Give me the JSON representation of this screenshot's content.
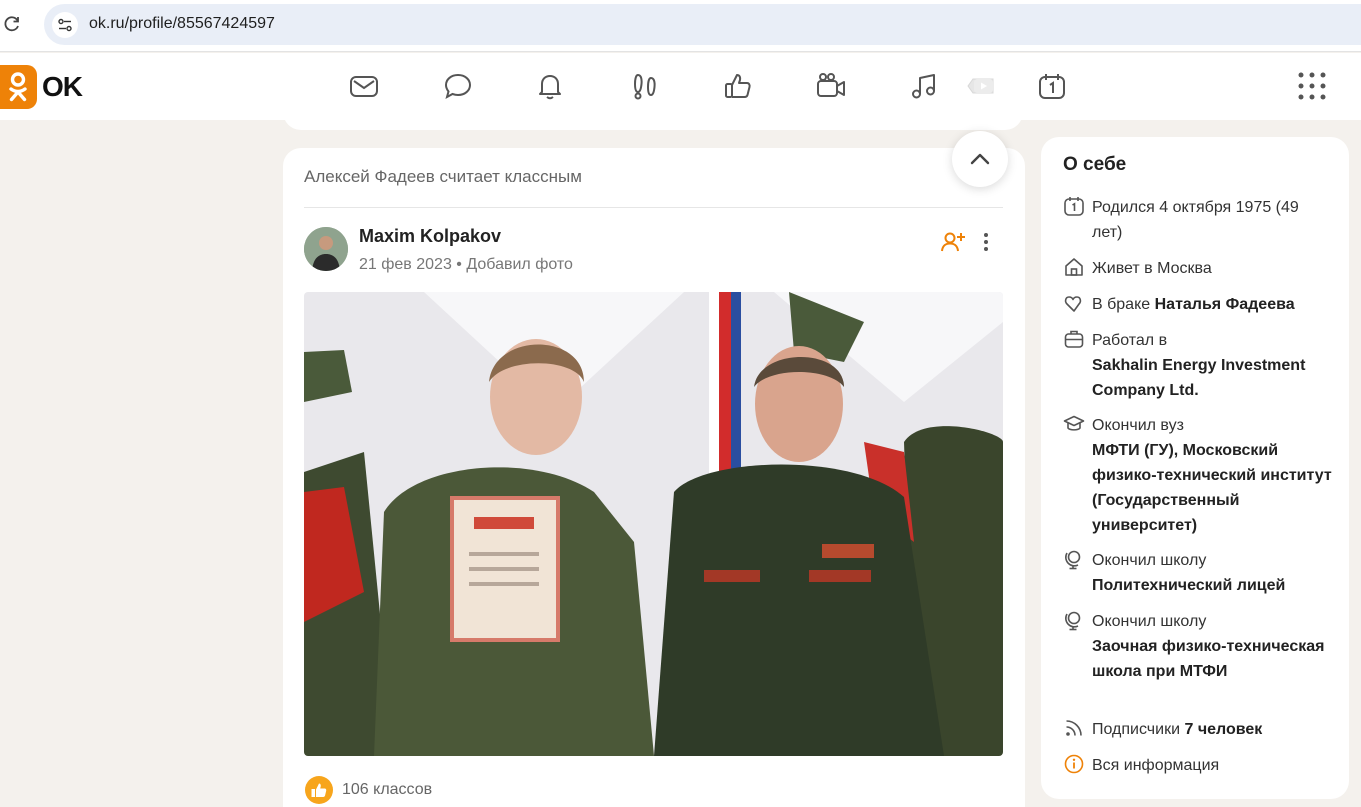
{
  "browser": {
    "url": "ok.ru/profile/85567424597"
  },
  "header": {
    "logo_text": "OK",
    "nav_icons": [
      "mail-icon",
      "chat-icon",
      "bell-icon",
      "guests-icon",
      "likes-icon",
      "video-camera-icon",
      "music-icon",
      "video-play-icon",
      "calendar-icon"
    ],
    "apps_icon": "apps-grid-icon"
  },
  "post": {
    "liked_by_line": "Алексей Фадеев считает классным",
    "author_name": "Maxim Kolpakov",
    "date": "21 фев 2023",
    "separator": "•",
    "action": "Добавил фото",
    "likes_count": "106 классов"
  },
  "about": {
    "title": "О себе",
    "born": "Родился 4 октября 1975 (49 лет)",
    "lives": "Живет в Москва",
    "married_prefix": "В браке ",
    "married_name": "Наталья Фадеева",
    "worked_prefix": "Работал в",
    "worked_company": "Sakhalin Energy Investment Company Ltd.",
    "university_prefix": "Окончил вуз",
    "university_name": "МФТИ (ГУ), Московский физико-технический институт (Государственный университет)",
    "school1_prefix": "Окончил школу",
    "school1_name": "Политехнический лицей",
    "school2_prefix": "Окончил школу",
    "school2_name": "Заочная физико-техническая школа при МТФИ",
    "followers_prefix": "Подписчики ",
    "followers_count": "7 человек",
    "all_info": "Вся информация"
  },
  "colors": {
    "accent": "#ee8208",
    "page_bg": "#f4f1ed",
    "like_badge": "#f7a51c"
  }
}
